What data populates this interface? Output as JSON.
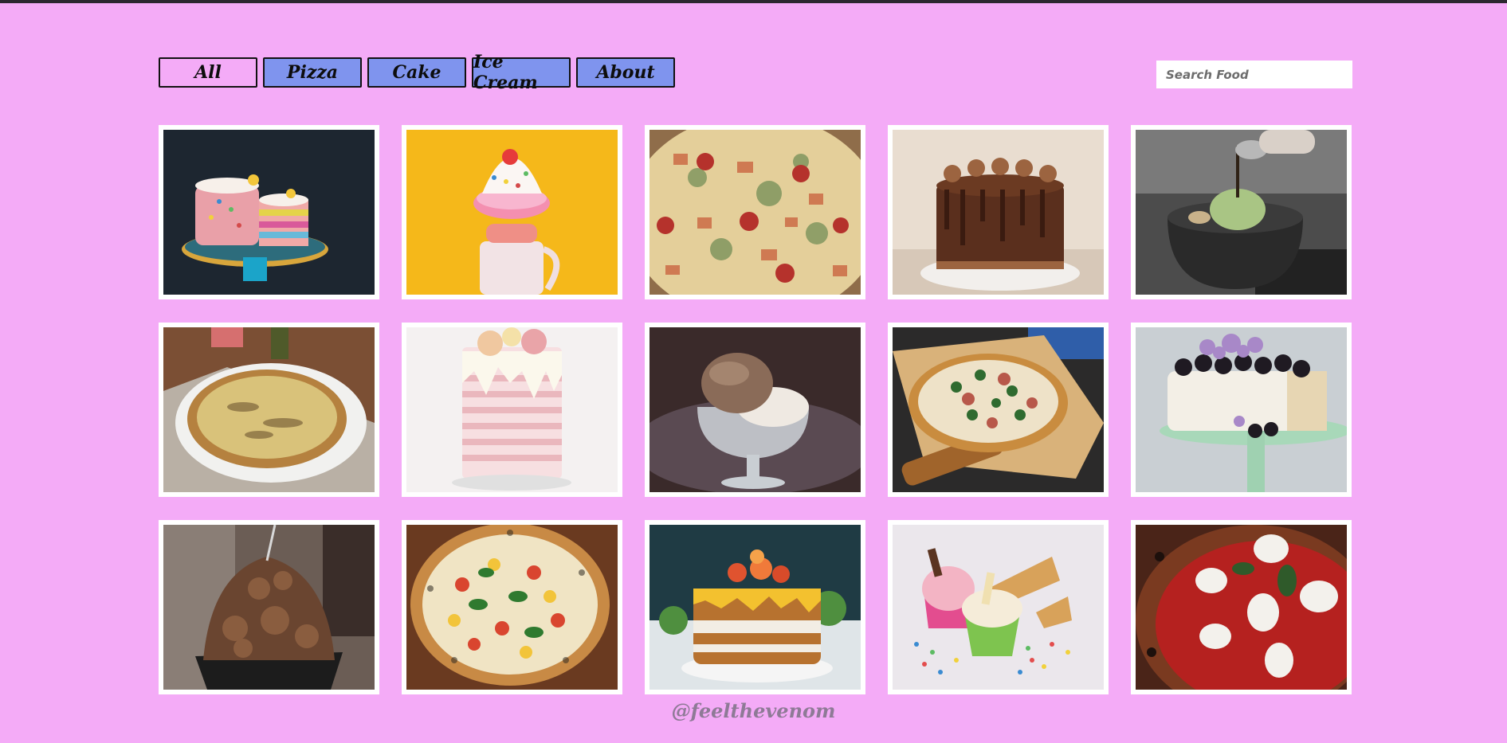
{
  "nav": {
    "filters": [
      {
        "label": "All",
        "active": true
      },
      {
        "label": "Pizza",
        "active": false
      },
      {
        "label": "Cake",
        "active": false
      },
      {
        "label": "Ice Cream",
        "active": false
      },
      {
        "label": "About",
        "active": false
      }
    ]
  },
  "search": {
    "placeholder": "Search Food",
    "value": ""
  },
  "gallery": {
    "items": [
      {
        "category": "Cake",
        "icon": "sprinkle-cake-photo"
      },
      {
        "category": "Ice Cream",
        "icon": "freakshake-photo"
      },
      {
        "category": "Pizza",
        "icon": "pizza-closeup-photo"
      },
      {
        "category": "Cake",
        "icon": "chocolate-drip-cake-photo"
      },
      {
        "category": "Ice Cream",
        "icon": "matcha-ice-cream-bowl-photo"
      },
      {
        "category": "Pizza",
        "icon": "pizza-on-plate-photo"
      },
      {
        "category": "Cake",
        "icon": "pink-drip-cake-photo"
      },
      {
        "category": "Ice Cream",
        "icon": "ice-cream-sundae-glass-photo"
      },
      {
        "category": "Pizza",
        "icon": "pizza-on-board-photo"
      },
      {
        "category": "Cake",
        "icon": "blackberry-cake-photo"
      },
      {
        "category": "Ice Cream",
        "icon": "chocolate-ice-cream-photo"
      },
      {
        "category": "Pizza",
        "icon": "margherita-pizza-photo"
      },
      {
        "category": "Cake",
        "icon": "orange-layer-cake-photo"
      },
      {
        "category": "Ice Cream",
        "icon": "ice-cream-cups-photo"
      },
      {
        "category": "Pizza",
        "icon": "mozzarella-pizza-photo"
      }
    ]
  },
  "footer": {
    "credit": "@feelthevenom"
  },
  "colors": {
    "page_bg": "#f4abf7",
    "filter_bg": "#7f94ee",
    "footer_text": "#8e7a96"
  }
}
